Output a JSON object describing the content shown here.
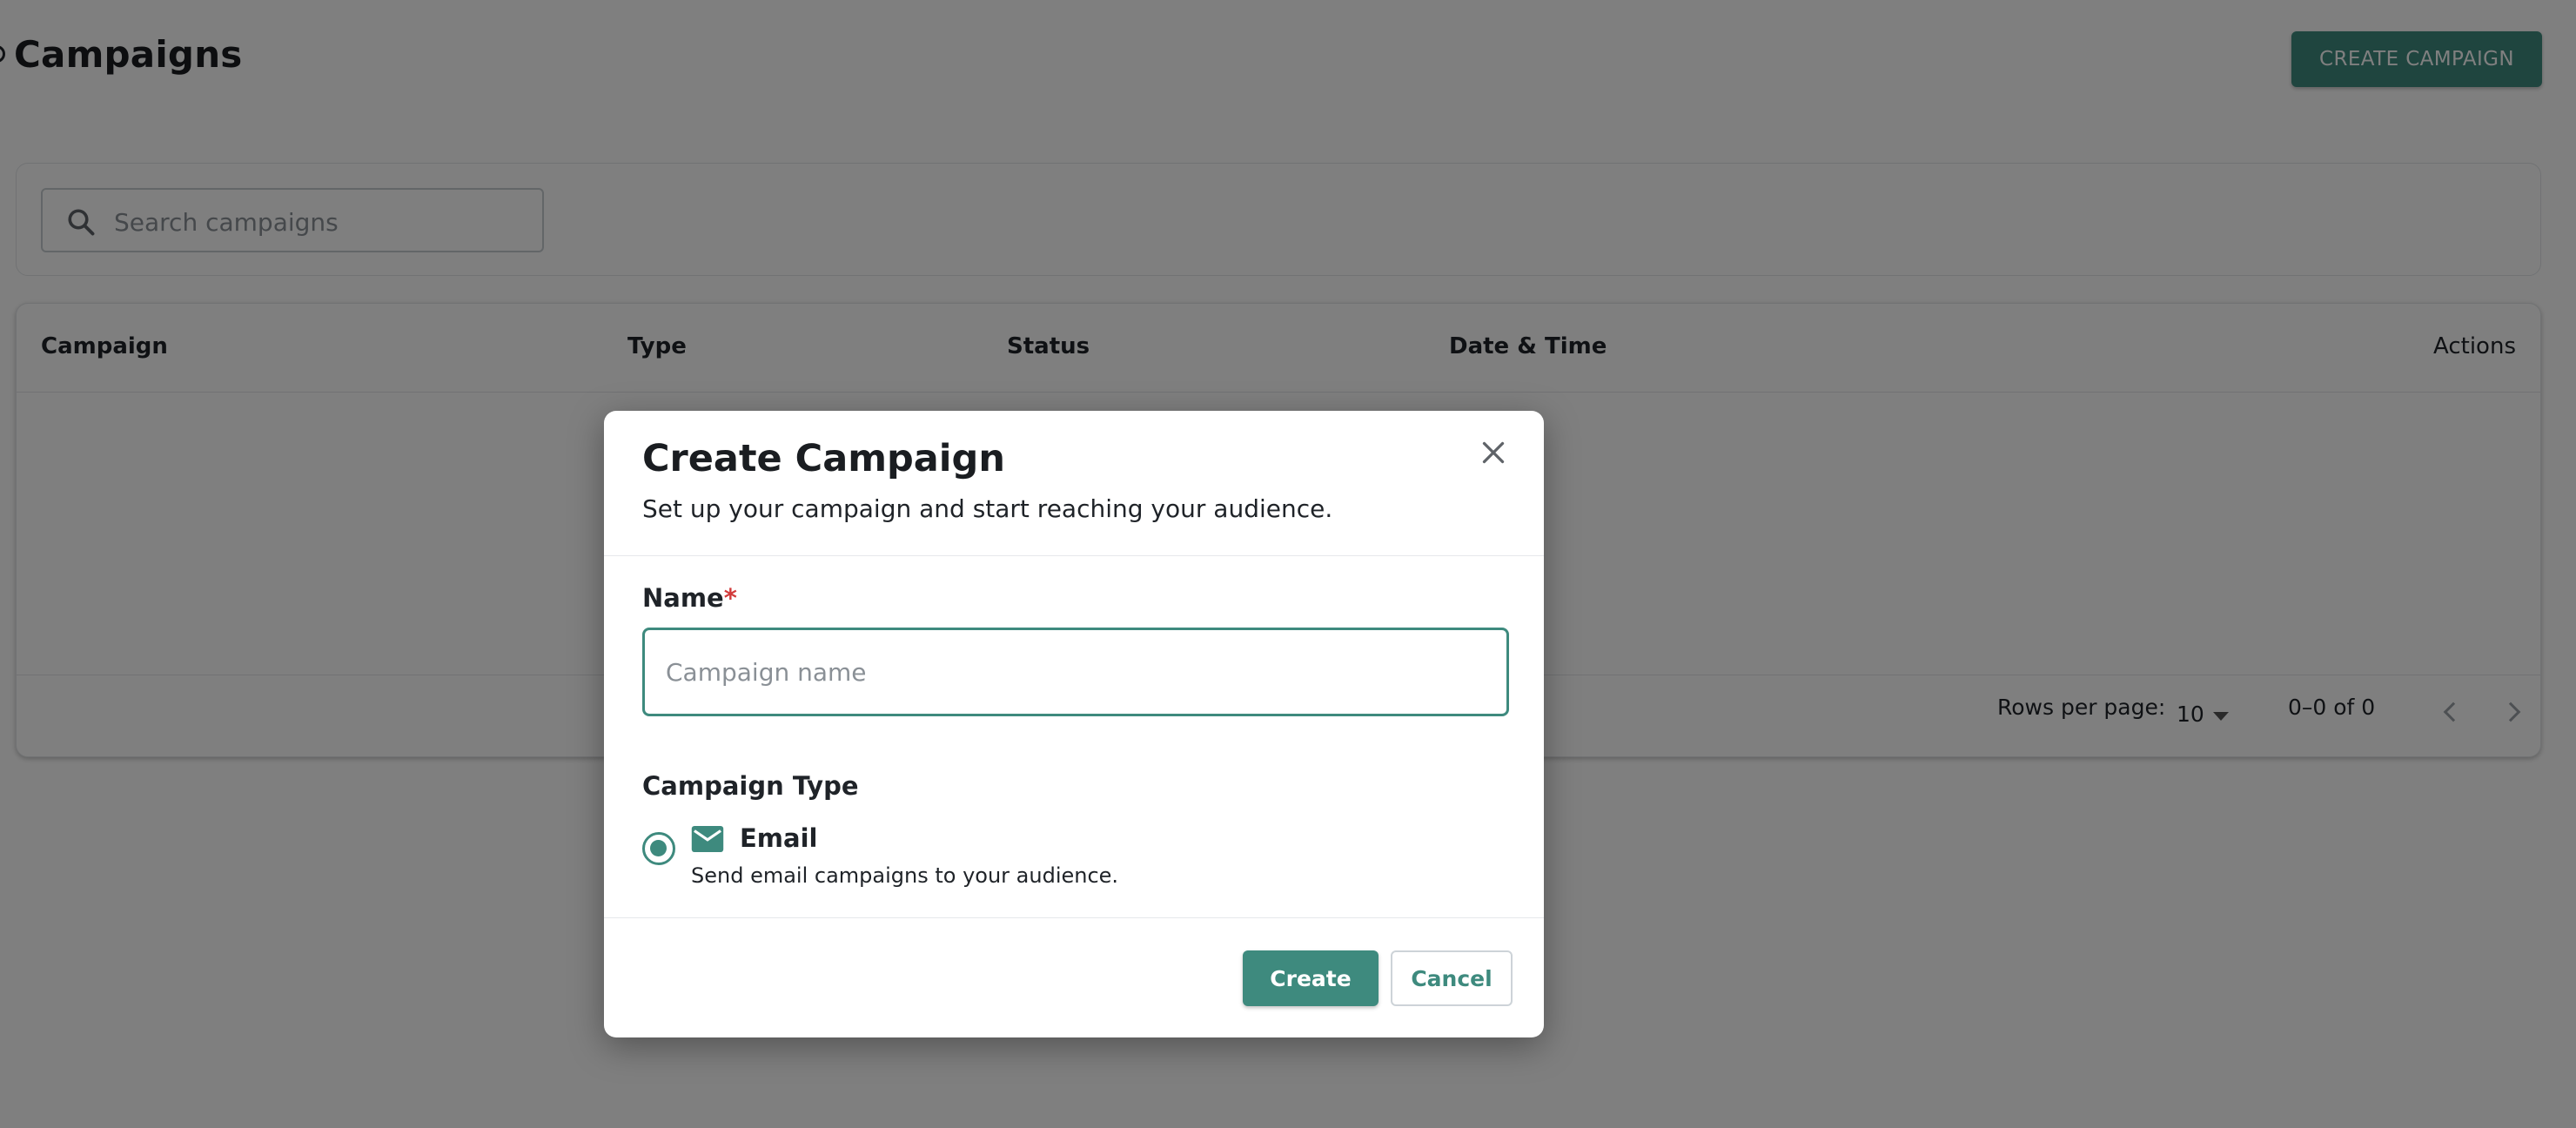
{
  "page": {
    "title": "Campaigns",
    "create_button_label": "CREATE CAMPAIGN"
  },
  "search": {
    "placeholder": "Search campaigns",
    "icon": "search-icon"
  },
  "table": {
    "columns": [
      "Campaign",
      "Type",
      "Status",
      "Date & Time",
      "Actions"
    ],
    "rows": [],
    "footer": {
      "rows_per_page_label": "Rows per page:",
      "rows_per_page_value": "10",
      "range_label": "0–0 of 0"
    }
  },
  "dialog": {
    "title": "Create Campaign",
    "subtitle": "Set up your campaign and start reaching your audience.",
    "name_label": "Name",
    "name_required_mark": "*",
    "name_placeholder": "Campaign name",
    "name_value": "",
    "campaign_type_label": "Campaign Type",
    "type_options": [
      {
        "label": "Email",
        "description": "Send email campaigns to your audience.",
        "icon": "email-icon",
        "selected": true
      }
    ],
    "create_label": "Create",
    "cancel_label": "Cancel"
  },
  "colors": {
    "accent": "#3e8a7e",
    "required": "#d23b3b",
    "overlay": "rgba(0,0,0,0.5)"
  }
}
